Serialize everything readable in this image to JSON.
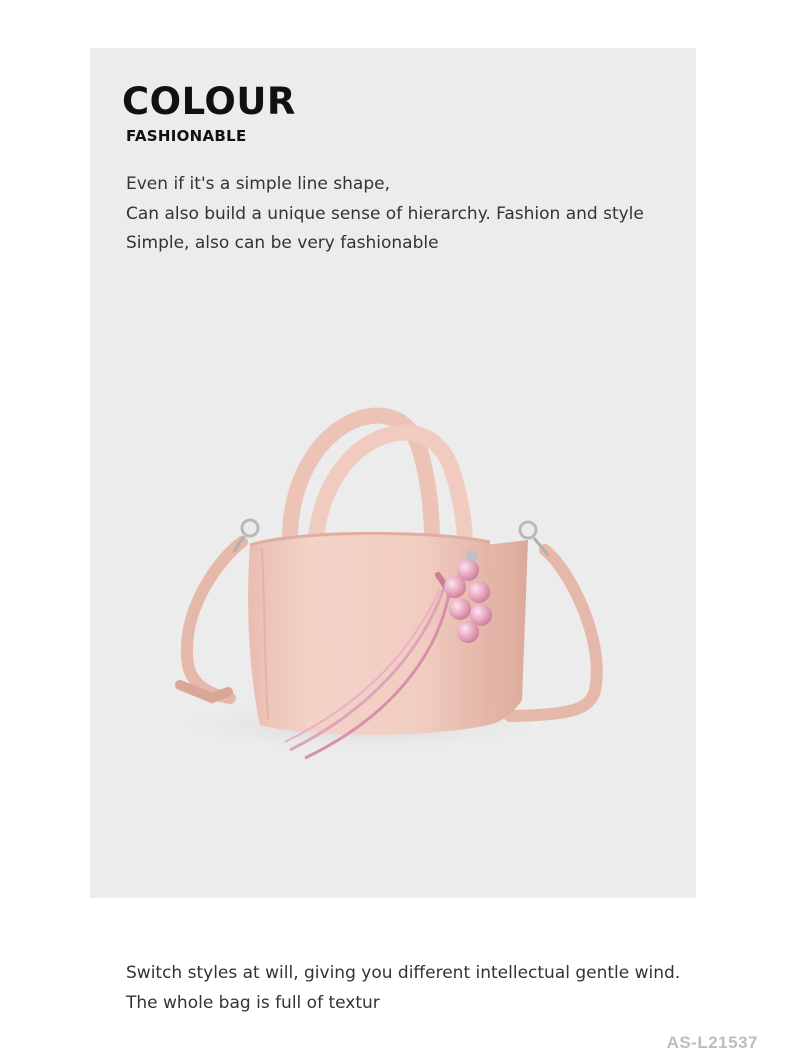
{
  "header": {
    "title": "COLOUR",
    "subtitle": "FASHIONABLE"
  },
  "description": {
    "lines": [
      "Even if it's a simple line shape,",
      "Can also build a unique sense of hierarchy. Fashion and style",
      "Simple, also can be very fashionable"
    ]
  },
  "product": {
    "bag_color": "#f0cbbf",
    "charm_color": "#e8a3bd"
  },
  "footer": {
    "lines": [
      "Switch styles at will, giving you different intellectual gentle wind.",
      "The whole bag is full of textur"
    ],
    "sku": "AS-L21537"
  },
  "colors": {
    "panel_background": "#ececec",
    "text": "#333333",
    "heading": "#111111",
    "sku_text": "#bdbdbd"
  }
}
